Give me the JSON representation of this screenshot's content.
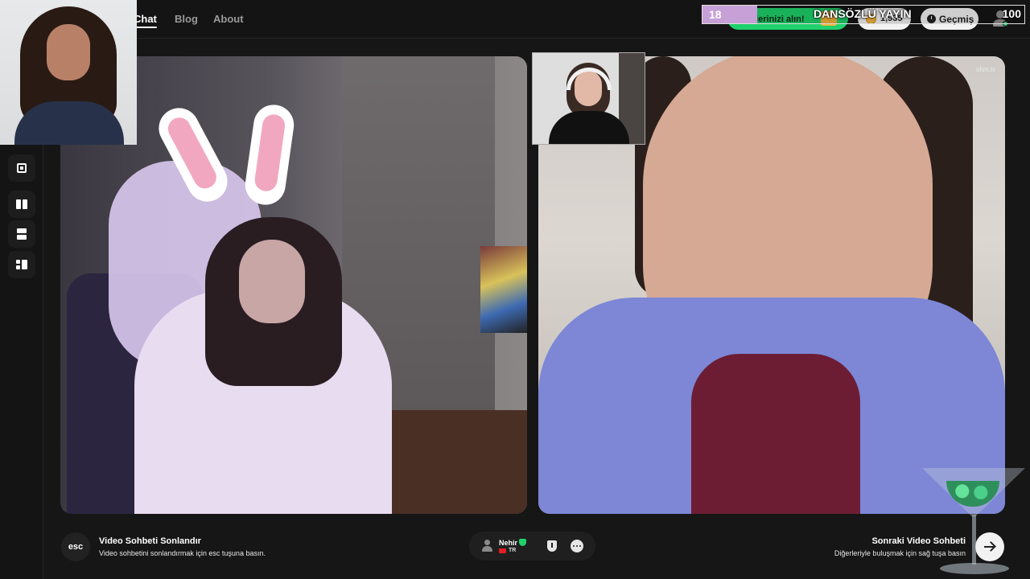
{
  "nav": {
    "links": [
      "Chat",
      "Blog",
      "About"
    ]
  },
  "header": {
    "promo_label": "llerinizi alın!",
    "coins_value": "1,935",
    "history_label": "Geçmiş"
  },
  "stream_overlay": {
    "counter": "18",
    "title": "DANSÖZLÜ YAYIN",
    "goal": "100"
  },
  "sidebar": {
    "buttons": [
      "exit-fullscreen",
      "split-vertical",
      "split-horizontal",
      "grid-layout"
    ]
  },
  "video": {
    "right_watermark": "ohm.tv"
  },
  "bottom": {
    "esc_key": "esc",
    "end_title": "Video Sohbeti Sonlandır",
    "end_desc": "Video sohbetini sonlandırmak için esc tuşuna basın.",
    "user_name": "Nehir",
    "country": "TR",
    "next_title": "Sonraki Video Sohbeti",
    "next_desc": "Diğerleriyle buluşmak için sağ tuşa basın"
  },
  "colors": {
    "accent_green": "#1fd16c",
    "coin_gold": "#f4b63e",
    "background": "#161616"
  }
}
